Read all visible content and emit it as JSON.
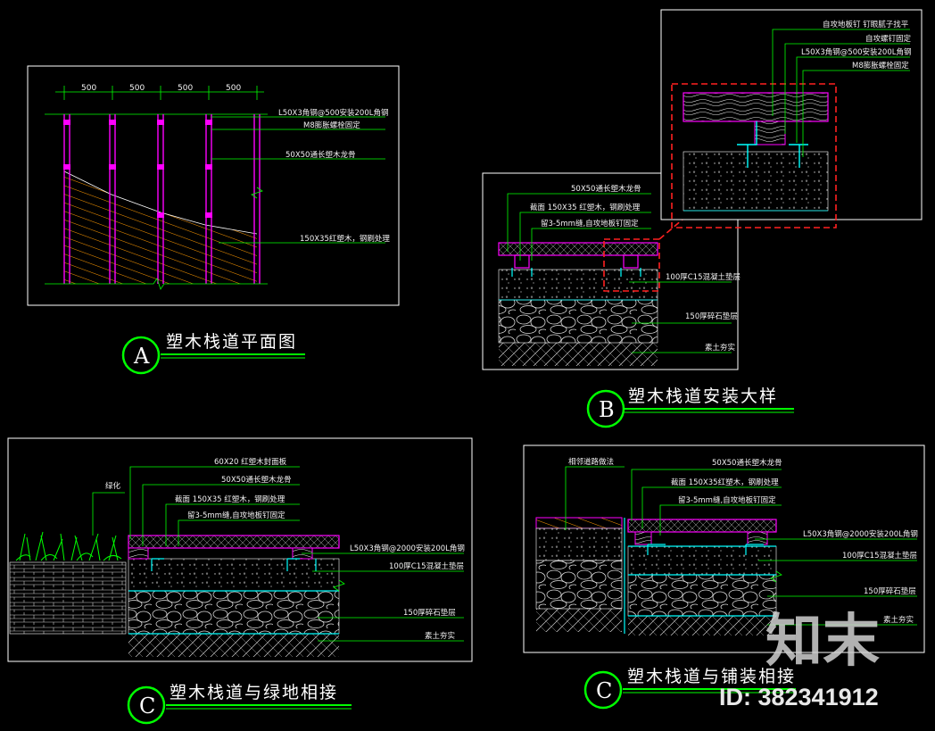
{
  "panel_a": {
    "title": "塑木栈道平面图",
    "letter": "A",
    "dims": [
      "500",
      "500",
      "500",
      "500"
    ],
    "callouts": [
      "L50X3角钢@500安装200L角钢",
      "M8膨胀螺栓固定",
      "50X50通长塑木龙骨",
      "150X35红塑木，钢刷处理"
    ]
  },
  "panel_b": {
    "title": "塑木栈道安装大样",
    "letter": "B",
    "callouts": [
      "50X50通长塑木龙骨",
      "截面 150X35 红塑木，钢刷处理",
      "留3-5mm缝,自攻地板钉固定",
      "100厚C15混凝土垫层",
      "150厚碎石垫层",
      "素土夯实"
    ],
    "detail_callouts": [
      "自攻地板钉  钉眼腻子找平",
      "自攻螺钉固定",
      "L50X3角钢@500安装200L角钢",
      "M8膨胀螺栓固定"
    ]
  },
  "panel_c1": {
    "title": "塑木栈道与绿地相接",
    "letter": "C",
    "side_label": "绿化",
    "callouts": [
      "60X20 红塑木封面板",
      "50X50通长塑木龙骨",
      "截面 150X35 红塑木，钢刷处理",
      "留3-5mm缝,自攻地板钉固定",
      "L50X3角钢@2000安装200L角钢",
      "100厚C15混凝土垫层",
      "150厚碎石垫层",
      "素土夯实"
    ]
  },
  "panel_c2": {
    "title": "塑木栈道与铺装相接",
    "letter": "C",
    "side_label": "相邻道路做法",
    "callouts": [
      "50X50通长塑木龙骨",
      "截面 150X35红塑木，钢刷处理",
      "留3-5mm缝,自攻地板钉固定",
      "L50X3角钢@2000安装200L角钢",
      "100厚C15混凝土垫层",
      "150厚碎石垫层",
      "素土夯实"
    ]
  },
  "watermark": {
    "brand": "知末",
    "id_text": "ID: 382341912"
  },
  "colors": {
    "background": "#000000",
    "frame": "#ffffff",
    "leader": "#00ff00",
    "timber": "#ff00ff",
    "hatch": "#ff9900",
    "section_line": "#00ffff",
    "detail_box": "#ff2020"
  }
}
